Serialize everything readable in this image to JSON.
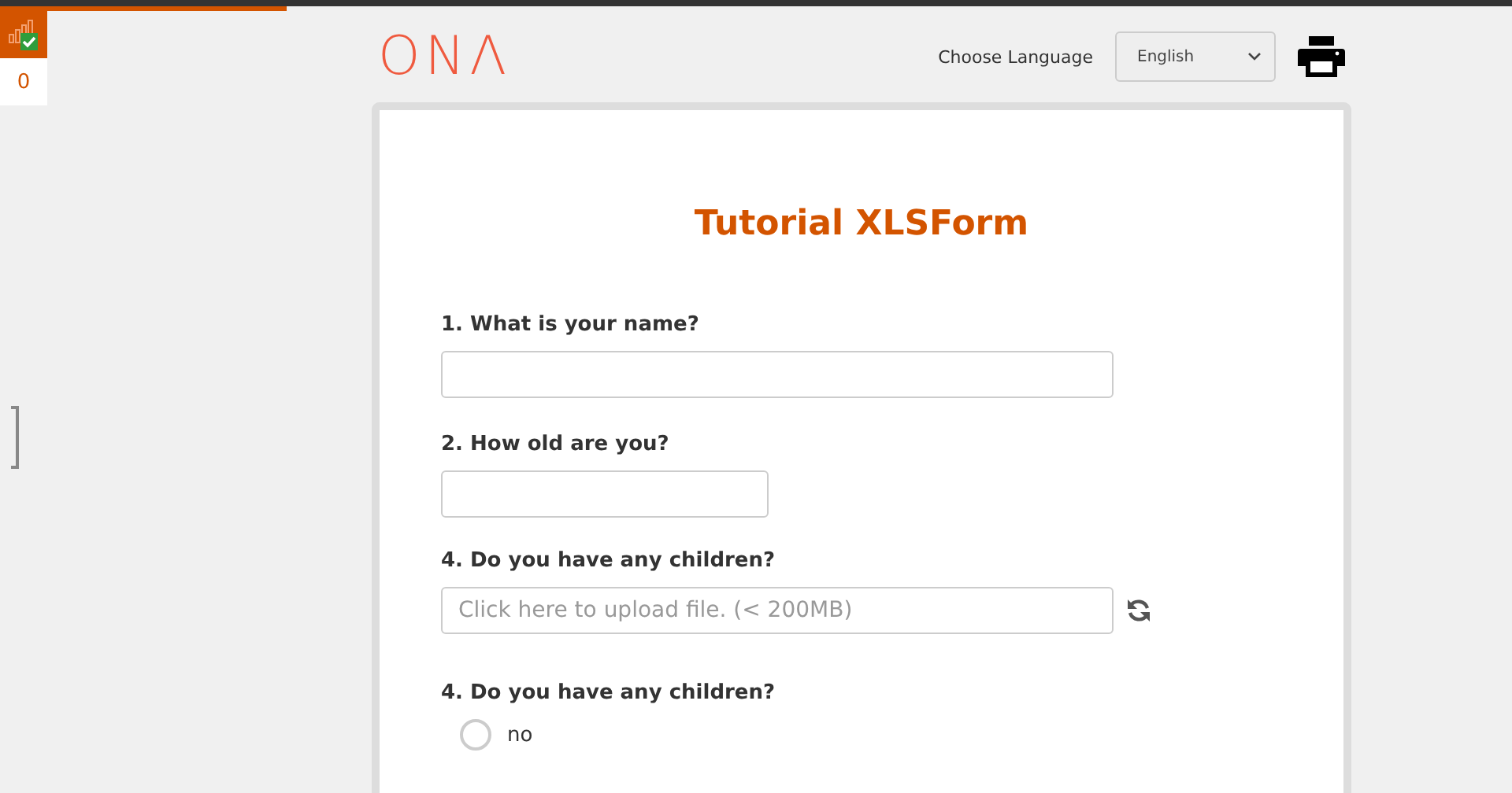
{
  "progress": {
    "level": 0.19
  },
  "status_widget": {
    "count": "0",
    "synced": true
  },
  "header": {
    "logo": "ONΛ",
    "language_label": "Choose Language",
    "language": "English"
  },
  "form": {
    "title": "Tutorial XLSForm",
    "questions": [
      {
        "kind": "text",
        "label": "1. What is your name?"
      },
      {
        "kind": "number",
        "label": "2. How old are you?"
      },
      {
        "kind": "file",
        "label": "4. Do you have any children?",
        "placeholder": "Click here to upload file. (< 200MB)"
      },
      {
        "kind": "radio",
        "label": "4. Do you have any children?",
        "options": [
          {
            "label": "no",
            "selected": false
          }
        ]
      }
    ]
  }
}
